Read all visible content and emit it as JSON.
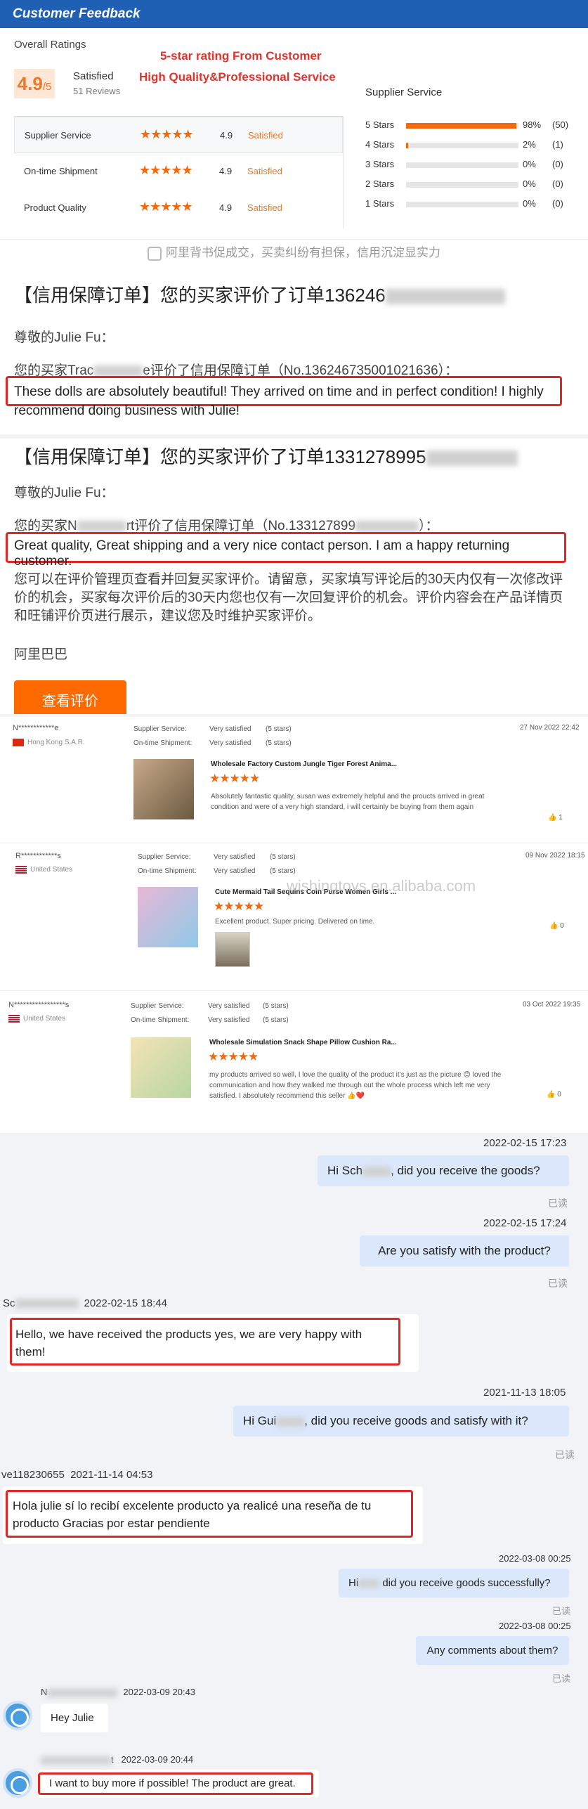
{
  "header": {
    "title": "Customer Feedback"
  },
  "overall": {
    "label": "Overall Ratings",
    "score": "4.9",
    "out_of": "/5",
    "satisfied": "Satisfied",
    "reviews": "51 Reviews"
  },
  "promo": {
    "line1": "5-star rating From Customer",
    "line2": "High Quality&Professional Service"
  },
  "ratings": [
    {
      "label": "Supplier Service",
      "value": "4.9",
      "status": "Satisfied"
    },
    {
      "label": "On-time Shipment",
      "value": "4.9",
      "status": "Satisfied"
    },
    {
      "label": "Product Quality",
      "value": "4.9",
      "status": "Satisfied"
    }
  ],
  "supplier_service": {
    "title": "Supplier Service",
    "rows": [
      {
        "label": "5 Stars",
        "pct": "98%",
        "count": "(50)",
        "fill": 0.98
      },
      {
        "label": "4 Stars",
        "pct": "2%",
        "count": "(1)",
        "fill": 0.02
      },
      {
        "label": "3 Stars",
        "pct": "0%",
        "count": "(0)",
        "fill": 0
      },
      {
        "label": "2 Stars",
        "pct": "0%",
        "count": "(0)",
        "fill": 0
      },
      {
        "label": "1 Stars",
        "pct": "0%",
        "count": "(0)",
        "fill": 0
      }
    ]
  },
  "banner": "阿里背书促成交，买卖纠纷有担保，信用沉淀显实力",
  "notice1": {
    "title": "【信用保障订单】您的买家评价了订单136246",
    "greeting": "尊敬的Julie Fu：",
    "line_a": "您的买家Trac",
    "line_b": "e评价了信用保障订单（No.136246735001021636）：",
    "review": "These dolls are absolutely beautiful! They arrived on time and in perfect condition! I highly recommend doing business with Julie!"
  },
  "notice2": {
    "title": "【信用保障订单】您的买家评价了订单1331278995",
    "greeting": "尊敬的Julie Fu：",
    "line_a": "您的买家N",
    "line_b": "rt评价了信用保障订单（No.133127899",
    "line_c": "）：",
    "review": "Great quality, Great shipping and a very nice contact person. I am a happy returning customer.",
    "para": "您可以在评价管理页查看并回复买家评价。请留意，买家填写评论后的30天内仅有一次修改评价的机会，买家每次评价后的30天内您也仅有一次回复评价的机会。评价内容会在产品详情页和旺铺评价页进行展示，建议您及时维护买家评价。",
    "sign": "阿里巴巴",
    "button": "查看评价"
  },
  "reviews": [
    {
      "buyer": "N************e",
      "country": "Hong Kong S.A.R.",
      "ss_label": "Supplier Service:",
      "ss_val": "Very satisfied",
      "ss_stars": "(5 stars)",
      "os_label": "On-time Shipment:",
      "os_val": "Very satisfied",
      "os_stars": "(5 stars)",
      "date": "27 Nov 2022 22:42",
      "product": "Wholesale Factory Custom Jungle Tiger Forest Anima...",
      "text": "Absolutely fantastic quality, susan was extremely helpful and the proucts arrived in great condition and were of a very high standard, i will certainly be buying from them again",
      "likes": "1"
    },
    {
      "buyer": "R************s",
      "country": "United States",
      "ss_label": "Supplier Service:",
      "ss_val": "Very satisfied",
      "ss_stars": "(5 stars)",
      "os_label": "On-time Shipment:",
      "os_val": "Very satisfied",
      "os_stars": "(5 stars)",
      "date": "09 Nov 2022 18:15",
      "product": "Cute Mermaid Tail Sequins Coin Purse Women Girls ...",
      "text": "Excellent product. Super pricing. Delivered on time.",
      "likes": "0"
    },
    {
      "buyer": "N*****************s",
      "country": "United States",
      "ss_label": "Supplier Service:",
      "ss_val": "Very satisfied",
      "ss_stars": "(5 stars)",
      "os_label": "On-time Shipment:",
      "os_val": "Very satisfied",
      "os_stars": "(5 stars)",
      "date": "03 Oct 2022 19:35",
      "product": "Wholesale Simulation Snack Shape Pillow Cushion Ra...",
      "text": "my products arrived so well, I love the quality of the product it's just as the picture 😊 loved the communication and how they walked me through out the whole process which left me very satisfied. I absolutely recommend this seller 👍❤️",
      "likes": "0"
    }
  ],
  "watermark": "wishingtoys.en.alibaba.com",
  "chat": {
    "c1": {
      "ts": "2022-02-15 17:23",
      "a": "Hi Sch",
      "b": ", did you receive the goods?",
      "read": "已读"
    },
    "c2": {
      "ts": "2022-02-15 17:24",
      "text": "Are you satisfy with the product?",
      "read": "已读"
    },
    "c3": {
      "name": "Sc",
      "ts": "2022-02-15 18:44",
      "text": "Hello, we have received the products yes, we are very happy with them!"
    },
    "c4": {
      "ts": "2021-11-13 18:05",
      "a": "Hi Gui",
      "b": ", did you receive goods and satisfy with it?",
      "read": "已读"
    },
    "c5": {
      "name": "ve118230655",
      "ts": "2021-11-14 04:53",
      "text": "Hola julie sí lo recibí excelente producto ya realicé una reseña de tu producto Gracias por estar pendiente"
    },
    "c6": {
      "ts": "2022-03-08 00:25",
      "a": "Hi",
      "b": " did you receive goods successfully?",
      "read": "已读"
    },
    "c7": {
      "ts": "2022-03-08 00:25",
      "text": "Any comments about them?",
      "read": "已读"
    },
    "c8": {
      "name": "N",
      "ts": "2022-03-09 20:43",
      "text": "Hey Julie"
    },
    "c9": {
      "name": "t",
      "ts": "2022-03-09 20:44",
      "text": "I want to buy more if possible! The product are great."
    }
  }
}
